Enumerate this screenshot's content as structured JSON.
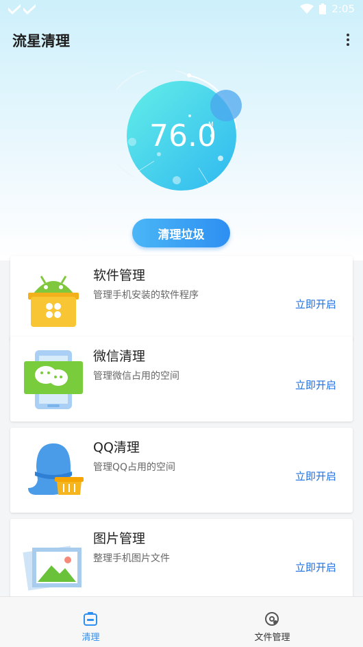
{
  "status_bar": {
    "time": "2:05"
  },
  "app_bar": {
    "title": "流星清理"
  },
  "gauge": {
    "value": "76.0",
    "unit": "M"
  },
  "clean_button": {
    "label": "清理垃圾"
  },
  "features": [
    {
      "title": "软件管理",
      "desc": "管理手机安装的软件程序",
      "action": "立即开启",
      "icon": "android-box-icon"
    },
    {
      "title": "微信清理",
      "desc": "管理微信占用的空间",
      "action": "立即开启",
      "icon": "wechat-icon"
    },
    {
      "title": "QQ清理",
      "desc": "管理QQ占用的空间",
      "action": "立即开启",
      "icon": "qq-icon"
    },
    {
      "title": "图片管理",
      "desc": "整理手机图片文件",
      "action": "立即开启",
      "icon": "picture-icon"
    }
  ],
  "bottom_nav": [
    {
      "label": "清理",
      "active": true,
      "icon": "clean-icon"
    },
    {
      "label": "文件管理",
      "active": false,
      "icon": "file-manage-icon"
    }
  ],
  "colors": {
    "accent": "#2d8ff2",
    "action_text": "#1e6fe0",
    "gauge": "#3fd6ea"
  }
}
